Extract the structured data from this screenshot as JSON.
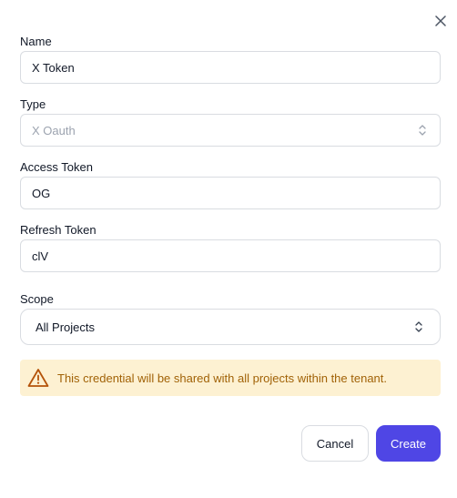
{
  "dialog": {
    "close_icon": "close-icon",
    "fields": {
      "name": {
        "label": "Name",
        "value": "X Token"
      },
      "type": {
        "label": "Type",
        "value": "X Oauth"
      },
      "access_token": {
        "label": "Access Token",
        "value": "OG"
      },
      "refresh_token": {
        "label": "Refresh Token",
        "value": "clV"
      },
      "scope": {
        "label": "Scope",
        "value": "All Projects"
      }
    },
    "warning": {
      "icon": "warning-icon",
      "text": "This credential will be shared with all projects within the tenant."
    },
    "buttons": {
      "cancel": "Cancel",
      "create": "Create"
    }
  },
  "colors": {
    "primary": "#4f46e5",
    "warning_bg": "#fdf1d2",
    "warning_text": "#a16207",
    "border": "#d9dce1",
    "disabled_text": "#9ca3af"
  }
}
